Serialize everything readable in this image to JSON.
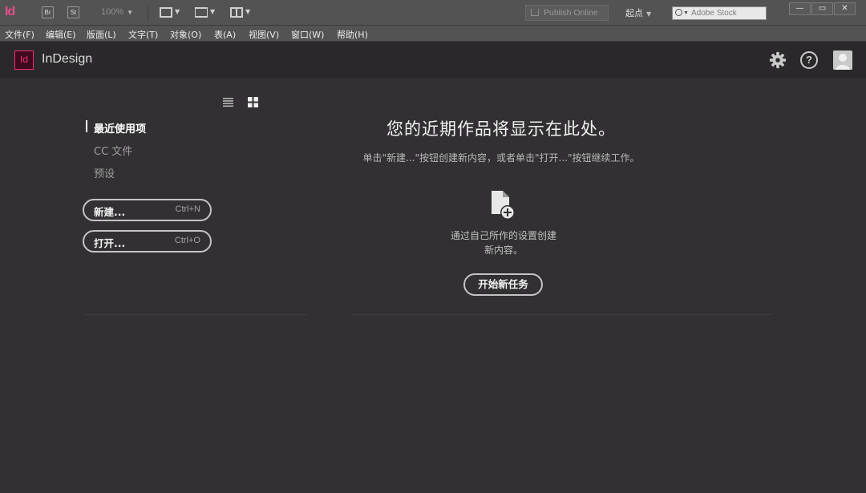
{
  "toolbar": {
    "app_logo": "Id",
    "bridge_label": "Br",
    "stock_label": "St",
    "zoom": "100%",
    "publish_label": "Publish Online",
    "workspace": "起点",
    "search_placeholder": "Adobe Stock",
    "window_controls": {
      "minimize": "—",
      "restore": "▭",
      "close": "✕"
    }
  },
  "menu": [
    "文件(F)",
    "编辑(E)",
    "版面(L)",
    "文字(T)",
    "对象(O)",
    "表(A)",
    "视图(V)",
    "窗口(W)",
    "帮助(H)"
  ],
  "header": {
    "badge": "Id",
    "title": "InDesign",
    "icons": [
      "gear-icon",
      "help-icon",
      "avatar-icon"
    ]
  },
  "sidebar": {
    "items": [
      {
        "label": "最近使用项",
        "active": true
      },
      {
        "label": "CC 文件",
        "active": false
      },
      {
        "label": "预设",
        "active": false
      }
    ],
    "new_button": {
      "label": "新建...",
      "shortcut": "Ctrl+N"
    },
    "open_button": {
      "label": "打开...",
      "shortcut": "Ctrl+O"
    }
  },
  "main": {
    "title": "您的近期作品将显示在此处。",
    "subtitle": "单击\"新建...\"按钮创建新内容，或者单击\"打开...\"按钮继续工作。",
    "caption_line1": "通过自己所作的设置创建",
    "caption_line2": "新内容。",
    "start_button": "开始新任务"
  },
  "colors": {
    "brand": "#ee2f74",
    "background": "#323032",
    "header_bg": "#2a282a",
    "chrome_bg": "#535353"
  }
}
